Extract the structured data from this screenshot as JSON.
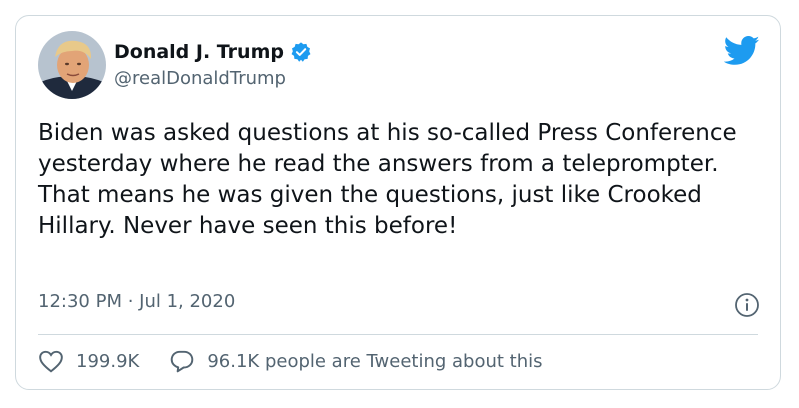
{
  "user": {
    "name": "Donald J. Trump",
    "handle": "@realDonaldTrump",
    "verified": true
  },
  "tweet": {
    "text": "Biden was asked questions at his so-called Press Conference yesterday where he read the answers from a teleprompter. That means he was given the questions, just like Crooked Hillary. Never have seen this before!",
    "timestamp": "12:30 PM · Jul 1, 2020"
  },
  "actions": {
    "likes": "199.9K",
    "tweeting": "96.1K people are Tweeting about this"
  },
  "icons": {
    "brand": "twitter-bird-icon",
    "verified": "verified-badge-icon",
    "info": "info-icon",
    "like": "heart-icon",
    "reply": "speech-bubble-icon"
  },
  "colors": {
    "brand_blue": "#1d9bf0",
    "text": "#0f1419",
    "muted": "#536471",
    "border": "#cfd9de"
  }
}
